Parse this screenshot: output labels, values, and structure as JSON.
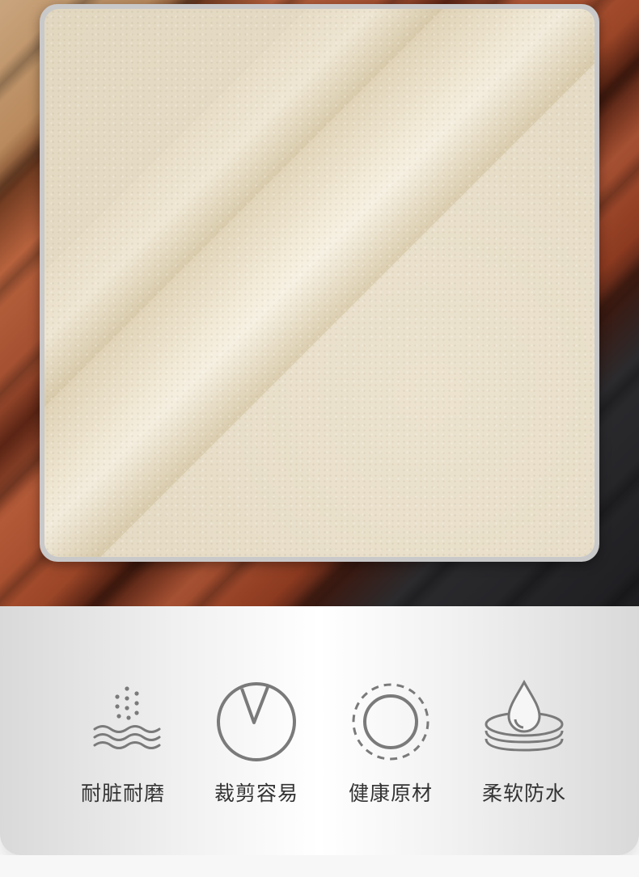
{
  "features": [
    {
      "label": "耐脏耐磨",
      "icon": "wear-resistant-icon"
    },
    {
      "label": "裁剪容易",
      "icon": "easy-cut-icon"
    },
    {
      "label": "健康原材",
      "icon": "healthy-material-icon"
    },
    {
      "label": "柔软防水",
      "icon": "waterproof-icon"
    }
  ],
  "colors": {
    "icon_stroke": "#7a7a7a",
    "label_text": "#333333",
    "swatch": "#ece3cf"
  }
}
